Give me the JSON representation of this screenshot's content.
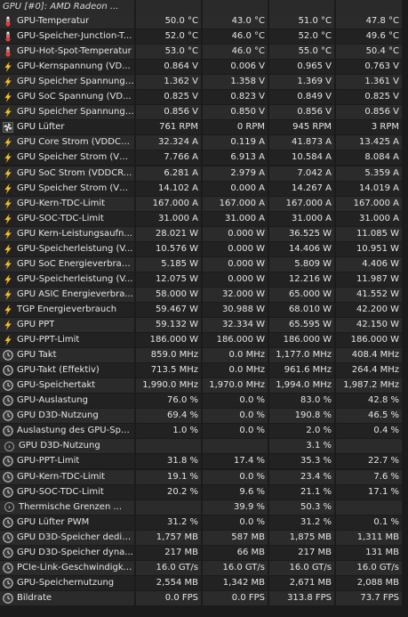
{
  "header": {
    "title": "GPU [#0]: AMD Radeon ..."
  },
  "rows": [
    {
      "icon": "thermometer-icon",
      "name": "GPU-Temperatur",
      "v": [
        "50.0 °C",
        "43.0 °C",
        "51.0 °C",
        "47.8 °C"
      ]
    },
    {
      "icon": "thermometer-icon",
      "name": "GPU-Speicher-Junction-T...",
      "v": [
        "52.0 °C",
        "46.0 °C",
        "52.0 °C",
        "49.6 °C"
      ]
    },
    {
      "icon": "thermometer-icon",
      "name": "GPU-Hot-Spot-Temperatur",
      "v": [
        "53.0 °C",
        "46.0 °C",
        "55.0 °C",
        "50.4 °C"
      ]
    },
    {
      "icon": "lightning-icon",
      "name": "GPU-Kernspannung (VD...",
      "v": [
        "0.864 V",
        "0.006 V",
        "0.965 V",
        "0.763 V"
      ]
    },
    {
      "icon": "lightning-icon",
      "name": "GPU Speicher Spannung ...",
      "v": [
        "1.362 V",
        "1.358 V",
        "1.369 V",
        "1.361 V"
      ]
    },
    {
      "icon": "lightning-icon",
      "name": "GPU SoC Spannung (VD...",
      "v": [
        "0.825 V",
        "0.823 V",
        "0.849 V",
        "0.825 V"
      ]
    },
    {
      "icon": "lightning-icon",
      "name": "GPU Speicher Spannung ...",
      "v": [
        "0.856 V",
        "0.850 V",
        "0.856 V",
        "0.856 V"
      ]
    },
    {
      "icon": "fan-icon",
      "name": "GPU Lüfter",
      "v": [
        "761 RPM",
        "0 RPM",
        "945 RPM",
        "3 RPM"
      ]
    },
    {
      "icon": "lightning-icon",
      "name": "GPU Core Strom (VDDCR...",
      "v": [
        "32.324 A",
        "0.119 A",
        "41.873 A",
        "13.425 A"
      ]
    },
    {
      "icon": "lightning-icon",
      "name": "GPU Speicher Strom (VD...",
      "v": [
        "7.766 A",
        "6.913 A",
        "10.584 A",
        "8.084 A"
      ]
    },
    {
      "icon": "lightning-icon",
      "name": "GPU SoC Strom (VDDCR...",
      "v": [
        "6.281 A",
        "2.979 A",
        "7.042 A",
        "5.359 A"
      ]
    },
    {
      "icon": "lightning-icon",
      "name": "GPU Speicher Strom (VD...",
      "v": [
        "14.102 A",
        "0.000 A",
        "14.267 A",
        "14.019 A"
      ]
    },
    {
      "icon": "lightning-icon",
      "name": "GPU-Kern-TDC-Limit",
      "v": [
        "167.000 A",
        "167.000 A",
        "167.000 A",
        "167.000 A"
      ]
    },
    {
      "icon": "lightning-icon",
      "name": "GPU-SOC-TDC-Limit",
      "v": [
        "31.000 A",
        "31.000 A",
        "31.000 A",
        "31.000 A"
      ]
    },
    {
      "icon": "lightning-icon",
      "name": "GPU Kern-Leistungsaufn...",
      "v": [
        "28.021 W",
        "0.000 W",
        "36.525 W",
        "11.085 W"
      ]
    },
    {
      "icon": "lightning-icon",
      "name": "GPU-Speicherleistung (V...",
      "v": [
        "10.576 W",
        "0.000 W",
        "14.406 W",
        "10.951 W"
      ]
    },
    {
      "icon": "lightning-icon",
      "name": "GPU SoC Energieverbrau...",
      "v": [
        "5.185 W",
        "0.000 W",
        "5.809 W",
        "4.406 W"
      ]
    },
    {
      "icon": "lightning-icon",
      "name": "GPU-Speicherleistung (V...",
      "v": [
        "12.075 W",
        "0.000 W",
        "12.216 W",
        "11.987 W"
      ]
    },
    {
      "icon": "lightning-icon",
      "name": "GPU ASIC Energieverbra...",
      "v": [
        "58.000 W",
        "32.000 W",
        "65.000 W",
        "41.552 W"
      ]
    },
    {
      "icon": "lightning-icon",
      "name": "TGP Energieverbrauch",
      "v": [
        "59.467 W",
        "30.988 W",
        "68.010 W",
        "42.200 W"
      ]
    },
    {
      "icon": "lightning-icon",
      "name": "GPU PPT",
      "v": [
        "59.132 W",
        "32.334 W",
        "65.595 W",
        "42.150 W"
      ]
    },
    {
      "icon": "lightning-icon",
      "name": "GPU-PPT-Limit",
      "v": [
        "186.000 W",
        "186.000 W",
        "186.000 W",
        "186.000 W"
      ]
    },
    {
      "icon": "clock-icon",
      "name": "GPU Takt",
      "v": [
        "859.0 MHz",
        "0.0 MHz",
        "1,177.0 MHz",
        "408.4 MHz"
      ]
    },
    {
      "icon": "clock-icon",
      "name": "GPU-Takt (Effektiv)",
      "v": [
        "713.5 MHz",
        "0.0 MHz",
        "961.6 MHz",
        "264.4 MHz"
      ]
    },
    {
      "icon": "clock-icon",
      "name": "GPU-Speichertakt",
      "v": [
        "1,990.0 MHz",
        "1,970.0 MHz",
        "1,994.0 MHz",
        "1,987.2 MHz"
      ]
    },
    {
      "icon": "clock-icon",
      "name": "GPU-Auslastung",
      "v": [
        "76.0 %",
        "0.0 %",
        "83.0 %",
        "42.8 %"
      ]
    },
    {
      "icon": "clock-icon",
      "name": "GPU D3D-Nutzung",
      "v": [
        "69.4 %",
        "0.0 %",
        "190.8 %",
        "46.5 %"
      ]
    },
    {
      "icon": "clock-icon",
      "name": "Auslastung des GPU-Spe...",
      "v": [
        "1.0 %",
        "0.0 %",
        "2.0 %",
        "0.4 %"
      ]
    },
    {
      "icon": "collapse-icon",
      "name": "GPU D3D-Nutzung",
      "group": true,
      "v": [
        "",
        "",
        "3.1 %",
        ""
      ]
    },
    {
      "icon": "clock-icon",
      "name": "GPU-PPT-Limit",
      "v": [
        "31.8 %",
        "17.4 %",
        "35.3 %",
        "22.7 %"
      ]
    },
    {
      "icon": "clock-icon",
      "name": "GPU-Kern-TDC-Limit",
      "v": [
        "19.1 %",
        "0.0 %",
        "23.4 %",
        "7.6 %"
      ]
    },
    {
      "icon": "clock-icon",
      "name": "GPU-SOC-TDC-Limit",
      "v": [
        "20.2 %",
        "9.6 %",
        "21.1 %",
        "17.1 %"
      ]
    },
    {
      "icon": "collapse-icon",
      "name": "Thermische Grenzen ...",
      "group": true,
      "v": [
        "",
        "39.9 %",
        "50.3 %",
        ""
      ]
    },
    {
      "icon": "clock-icon",
      "name": "GPU Lüfter PWM",
      "v": [
        "31.2 %",
        "0.0 %",
        "31.2 %",
        "0.1 %"
      ]
    },
    {
      "icon": "clock-icon",
      "name": "GPU D3D-Speicher dedizi...",
      "v": [
        "1,757 MB",
        "587 MB",
        "1,875 MB",
        "1,311 MB"
      ]
    },
    {
      "icon": "clock-icon",
      "name": "GPU D3D-Speicher dyna...",
      "v": [
        "217 MB",
        "66 MB",
        "217 MB",
        "131 MB"
      ]
    },
    {
      "icon": "clock-icon",
      "name": "PCIe-Link-Geschwindigkeit",
      "v": [
        "16.0 GT/s",
        "16.0 GT/s",
        "16.0 GT/s",
        "16.0 GT/s"
      ]
    },
    {
      "icon": "clock-icon",
      "name": "GPU-Speichernutzung",
      "v": [
        "2,554 MB",
        "1,342 MB",
        "2,671 MB",
        "2,088 MB"
      ]
    },
    {
      "icon": "clock-icon",
      "name": "Bildrate",
      "v": [
        "0.0 FPS",
        "0.0 FPS",
        "313.8 FPS",
        "73.7 FPS"
      ]
    }
  ],
  "colors": {
    "thermometer": "#e23b3b",
    "lightning": "#f2c230",
    "clock": "#d9d9d9",
    "fan": "#cfcfcf"
  }
}
